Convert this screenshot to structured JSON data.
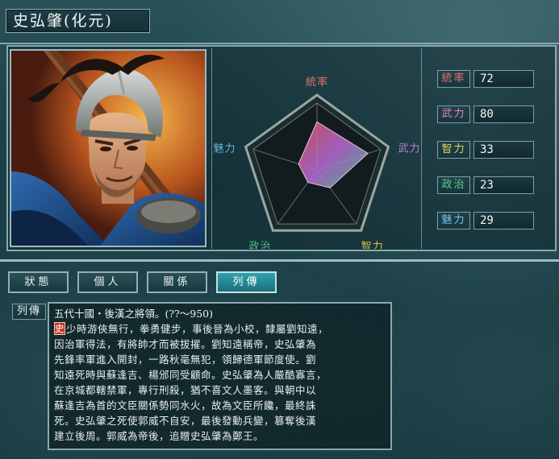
{
  "window": {
    "title": "史弘肇(化元)"
  },
  "radar": {
    "axes": [
      "統率",
      "武力",
      "智力",
      "政治",
      "魅力"
    ],
    "values": [
      72,
      80,
      33,
      23,
      29
    ],
    "max": 100,
    "axis_colors": [
      "#e8706a",
      "#c77be0",
      "#e0c24a",
      "#4fc28a",
      "#6db4d8"
    ]
  },
  "stats": [
    {
      "label": "統率",
      "value": "72",
      "color": "#e8706a"
    },
    {
      "label": "武力",
      "value": "80",
      "color": "#e880c8"
    },
    {
      "label": "智力",
      "value": "33",
      "color": "#e8d060"
    },
    {
      "label": "政治",
      "value": "23",
      "color": "#58d088"
    },
    {
      "label": "魅力",
      "value": "29",
      "color": "#78c0ee"
    }
  ],
  "tabs": [
    {
      "label": "狀態",
      "active": false
    },
    {
      "label": "個人",
      "active": false
    },
    {
      "label": "關係",
      "active": false
    },
    {
      "label": "列傳",
      "active": true
    }
  ],
  "bio": {
    "label": "列傳",
    "header": "五代十國・後漢之將領。(??～950)",
    "initial": "史",
    "lines": [
      "少時游俠無行，拳勇健步，事後晉為小校，隸屬劉知遠，",
      "因治軍得法，有將帥才而被拔擢。劉知遠稱帝，史弘肇為",
      "先鋒率軍進入開封，一路秋毫無犯，領歸德軍節度使。劉",
      "知遠死時與蘇逢吉、楊邠同受顧命。史弘肇為人嚴酷寡言，",
      "在京城都轄禁軍，專行刑殺，猶不喜文人墨客。與朝中以",
      "蘇逢吉為首的文臣關係勢同水火，故為文臣所饞，最終誅",
      "死。史弘肇之死使郭威不自安，最後發動兵變，篡奪後漢",
      "建立後周。郭威為帝後，追贈史弘肇為鄭王。"
    ]
  },
  "colors": {
    "background": "#173c43",
    "frame": "#8aa9ae",
    "active_tab": "#2fa2ad",
    "initial_badge": "#c0392b"
  }
}
